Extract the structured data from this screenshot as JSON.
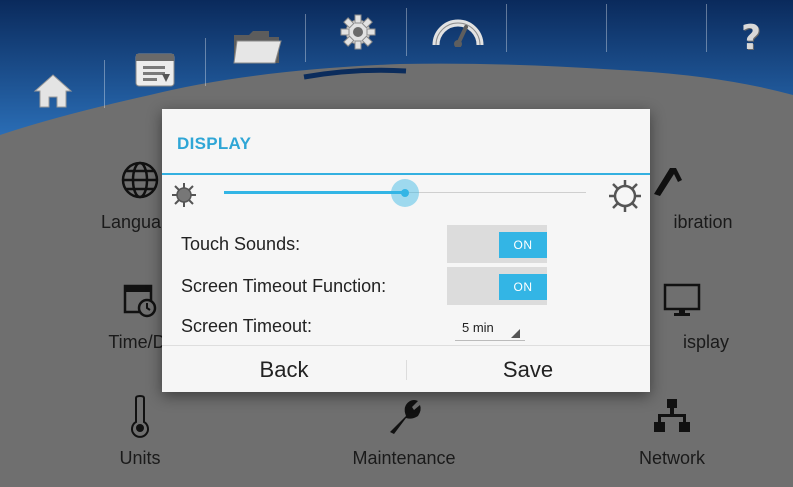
{
  "toolbar": {
    "items": [
      "home-icon",
      "report-icon",
      "folder-icon",
      "settings-gear-icon",
      "gauge-icon",
      "help-icon"
    ],
    "help_label": "?",
    "active_item": "settings-gear-icon",
    "colors": {
      "bar_top": "#0a2a5c",
      "bar_bottom": "#1f5fa8",
      "active_underline": "#0b2c5c"
    }
  },
  "tiles": {
    "language": "Langua",
    "calibration": "ibration",
    "time_date": "Time/D",
    "display": "isplay",
    "units": "Units",
    "maintenance": "Maintenance",
    "network": "Network"
  },
  "dialog": {
    "title": "DISPLAY",
    "brightness_fraction": 0.5,
    "touch_sounds_label": "Touch Sounds:",
    "touch_sounds_state": "ON",
    "screen_timeout_function_label": "Screen Timeout Function:",
    "screen_timeout_function_state": "ON",
    "screen_timeout_label": "Screen Timeout:",
    "screen_timeout_value": "5 min",
    "back_label": "Back",
    "save_label": "Save",
    "accent_color": "#33b5e5"
  }
}
